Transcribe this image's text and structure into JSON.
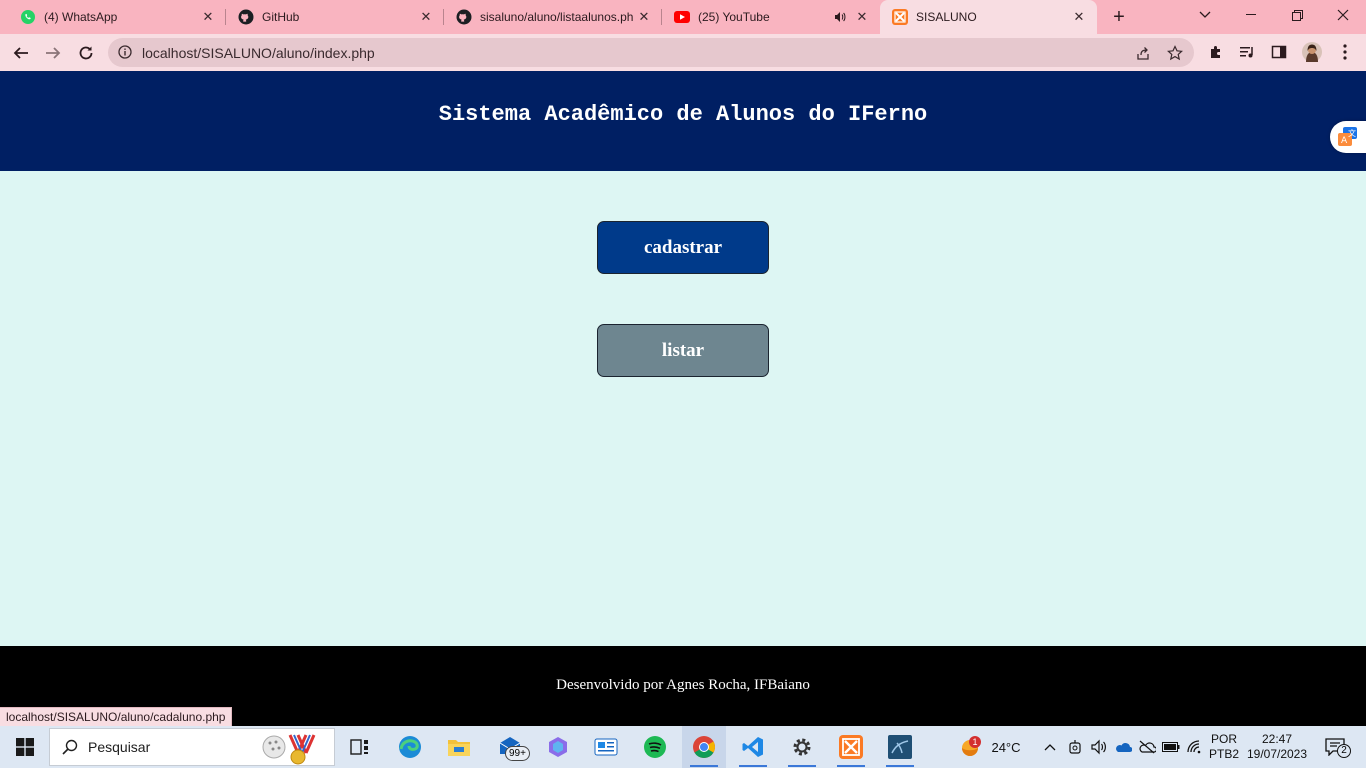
{
  "browser": {
    "tabs": [
      {
        "title": "(4) WhatsApp",
        "icon": "whatsapp-icon"
      },
      {
        "title": "GitHub",
        "icon": "github-icon"
      },
      {
        "title": "sisaluno/aluno/listaalunos.ph",
        "icon": "github-icon"
      },
      {
        "title": "(25) YouTube",
        "icon": "youtube-icon"
      },
      {
        "title": "SISALUNO",
        "icon": "xampp-icon"
      }
    ],
    "active_tab": 4,
    "url": "localhost/SISALUNO/aluno/index.php",
    "status_url": "localhost/SISALUNO/aluno/cadaluno.php"
  },
  "page": {
    "title": "Sistema Acadêmico de Alunos do IFerno",
    "buttons": {
      "cadastrar": "cadastrar",
      "listar": "listar"
    },
    "footer": "Desenvolvido por Agnes Rocha, IFBaiano"
  },
  "taskbar": {
    "search_placeholder": "Pesquisar",
    "mail_badge": "99+",
    "weather_badge": "1",
    "temperature": "24°C",
    "language": "POR",
    "keyboard": "PTB2",
    "time": "22:47",
    "date": "19/07/2023",
    "notifications": "2"
  },
  "colors": {
    "header_bg": "#001f63",
    "page_bg": "#ddf6f3",
    "button_cadastrar": "#003a8a",
    "button_listar": "#6e8690",
    "footer_bg": "#000000",
    "tabstrip_bg": "#f9b4c0"
  }
}
